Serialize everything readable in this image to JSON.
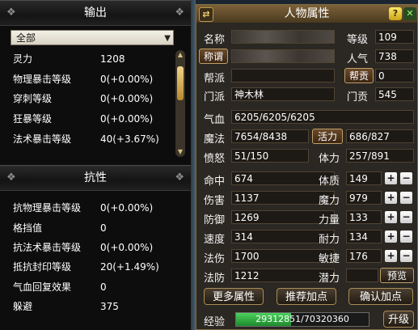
{
  "left": {
    "output_header": "输出",
    "dropdown_value": "全部",
    "output_stats": [
      {
        "label": "灵力",
        "value": "1208"
      },
      {
        "label": "物理暴击等级",
        "value": "0(+0.00%)"
      },
      {
        "label": "穿刺等级",
        "value": "0(+0.00%)"
      },
      {
        "label": "狂暴等级",
        "value": "0(+0.00%)"
      },
      {
        "label": "法术暴击等级",
        "value": "40(+3.67%)"
      }
    ],
    "resist_header": "抗性",
    "resist_stats": [
      {
        "label": "抗物理暴击等级",
        "value": "0(+0.00%)"
      },
      {
        "label": "格挡值",
        "value": "0"
      },
      {
        "label": "抗法术暴击等级",
        "value": "0(+0.00%)"
      },
      {
        "label": "抵抗封印等级",
        "value": "20(+1.49%)"
      },
      {
        "label": "气血回复效果",
        "value": "0"
      },
      {
        "label": "躲避",
        "value": "375"
      }
    ]
  },
  "panel": {
    "title": "人物属性",
    "help": "?",
    "close": "✕",
    "menu": "⇄",
    "name_label": "名称",
    "level_label": "等级",
    "level_value": "109",
    "title_button": "称谓",
    "popularity_label": "人气",
    "popularity_value": "738",
    "faction_label": "帮派",
    "contribution_button": "帮贡",
    "contribution_value": "0",
    "sect_label": "门派",
    "sect_value": "神木林",
    "sect_contrib_label": "门贡",
    "sect_contrib_value": "545",
    "hp_label": "气血",
    "hp_value": "6205/6205/6205",
    "mp_label": "魔法",
    "mp_value": "7654/8438",
    "vitality_button": "活力",
    "vitality_value": "686/827",
    "anger_label": "愤怒",
    "anger_value": "51/150",
    "stamina_label": "体力",
    "stamina_value": "257/891",
    "combat_stats": [
      {
        "label": "命中",
        "value": "674"
      },
      {
        "label": "伤害",
        "value": "1137"
      },
      {
        "label": "防御",
        "value": "1269"
      },
      {
        "label": "速度",
        "value": "314"
      },
      {
        "label": "法伤",
        "value": "1700"
      },
      {
        "label": "法防",
        "value": "1212"
      }
    ],
    "attributes": [
      {
        "label": "体质",
        "value": "149"
      },
      {
        "label": "魔力",
        "value": "979"
      },
      {
        "label": "力量",
        "value": "133"
      },
      {
        "label": "耐力",
        "value": "134"
      },
      {
        "label": "敏捷",
        "value": "176"
      }
    ],
    "potential_label": "潜力",
    "preview_button": "预览",
    "more_button": "更多属性",
    "recommend_button": "推荐加点",
    "confirm_button": "确认加点",
    "exp_label": "经验",
    "exp_value": "29312851/70320360",
    "exp_fraction": 0.417,
    "upgrade_button": "升级",
    "plus_symbol": "+",
    "minus_symbol": "−"
  }
}
